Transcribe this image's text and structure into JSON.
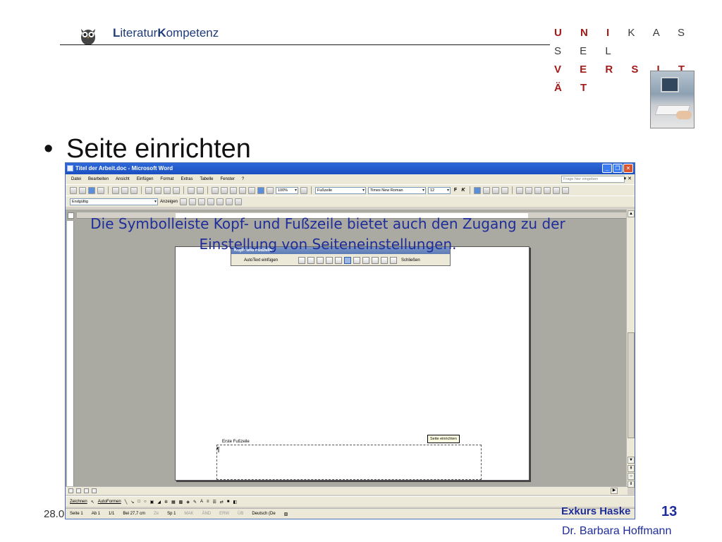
{
  "header": {
    "brand_part1": "L",
    "brand_part2": "iteratur",
    "brand_part3": "K",
    "brand_part4": "ompetenz",
    "university_row1_bold": "U N I",
    "university_row1_light": "K A S S E L",
    "university_row2": "V E R S I T Ä T"
  },
  "slide_title": "Seite einrichten",
  "caption": "Die Symbolleiste Kopf- und Fußzeile bietet auch den Zugang zu der Einstellung von Seiteneinstellungen.",
  "word": {
    "window_title": "Titel der Arbeit.doc - Microsoft Word",
    "menu": [
      "Datei",
      "Bearbeiten",
      "Ansicht",
      "Einfügen",
      "Format",
      "Extras",
      "Tabelle",
      "Fenster",
      "?"
    ],
    "help_placeholder": "Frage hier eingeben",
    "zoom": "100%",
    "style": "Fußzeile",
    "font": "Times New Roman",
    "font_size": "12",
    "bold": "F",
    "italic": "K",
    "review_combo": "Endgültig",
    "review_show": "Anzeigen",
    "hf_toolbar_title": "Kopf- und Fußzeile",
    "hf_autotext": "AutoText einfügen",
    "hf_close": "Schließen",
    "tooltip": "Seite einrichten",
    "footer_label": "Erste Fußzeile",
    "draw_label": "Zeichnen",
    "autoformen": "AutoFormen",
    "status": {
      "page": "Seite 1",
      "section": "Ab 1",
      "pages": "1/1",
      "position": "Bei 27,7 cm",
      "line": "Ze",
      "col": "Sp 1",
      "mak": "MAK",
      "and": "ÄND",
      "erw": "ERW",
      "ub": "ÜB",
      "lang": "Deutsch (De"
    }
  },
  "footer": {
    "date": "28.0",
    "exkurs": "Exkurs Haske",
    "page_number": "13",
    "author": "Dr. Barbara Hoffmann"
  }
}
